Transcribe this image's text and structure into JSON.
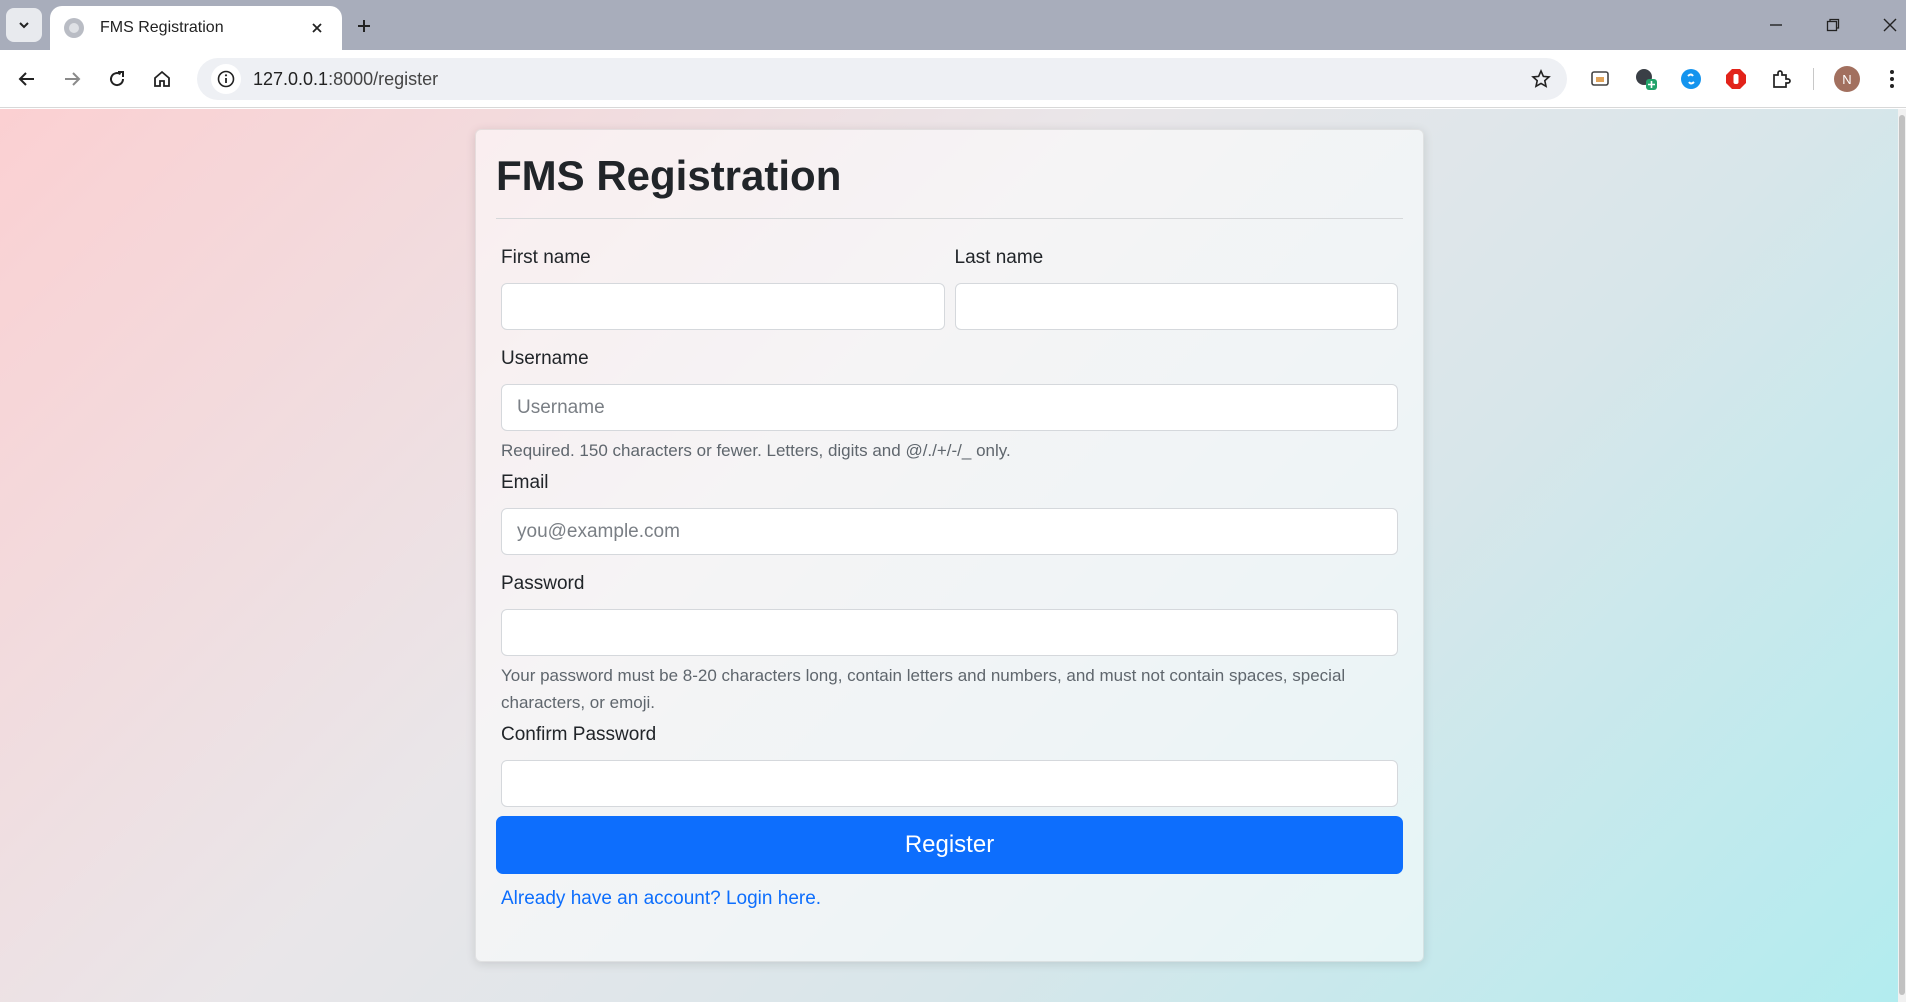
{
  "browser": {
    "tab_title": "FMS Registration",
    "url_host": "127.0.0.1",
    "url_path": ":8000/register",
    "profile_initial": "N"
  },
  "form": {
    "title": "FMS Registration",
    "first_name_label": "First name",
    "first_name_value": "",
    "last_name_label": "Last name",
    "last_name_value": "",
    "username_label": "Username",
    "username_placeholder": "Username",
    "username_help": "Required. 150 characters or fewer. Letters, digits and @/./+/-/_ only.",
    "email_label": "Email",
    "email_placeholder": "you@example.com",
    "password_label": "Password",
    "password_help": "Your password must be 8-20 characters long, contain letters and numbers, and must not contain spaces, special characters, or emoji.",
    "confirm_password_label": "Confirm Password",
    "register_button": "Register",
    "login_link": "Already have an account? Login here."
  },
  "colors": {
    "primary": "#0d6efd",
    "tabbar": "#a8adbb"
  }
}
